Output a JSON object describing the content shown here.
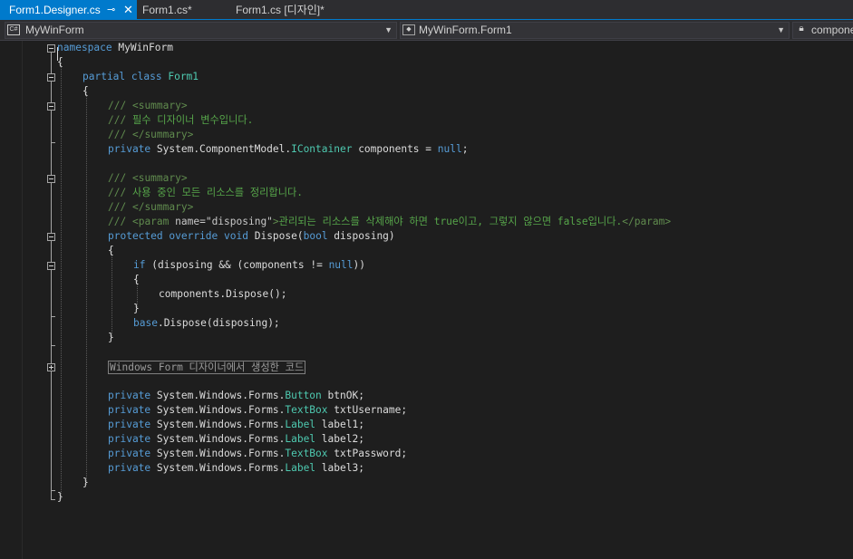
{
  "tabs": [
    {
      "label": "Form1.Designer.cs",
      "active": true,
      "pin": "⊸",
      "close": "✕"
    },
    {
      "label": "Form1.cs*"
    },
    {
      "label": "Form1.cs [디자인]*"
    }
  ],
  "navbar": {
    "project": {
      "icon": "C#",
      "label": "MyWinForm"
    },
    "class": {
      "label": "MyWinForm.Form1"
    },
    "member": {
      "label": "compone"
    }
  },
  "code": {
    "namespace_kw": "namespace",
    "namespace_name": " MyWinForm",
    "open_brace": "{",
    "close_brace": "}",
    "partial_kw": "partial",
    "class_kw": "class",
    "form_name": "Form1",
    "doc_prefix": "///",
    "summary_open": "<summary>",
    "summary_close": "</summary>",
    "comment_var": "필수 디자이너 변수입니다.",
    "private_kw": "private",
    "component_model": "System.ComponentModel.",
    "icontainer": "IContainer",
    "components_decl": " components = ",
    "null_kw": "null",
    "semi": ";",
    "comment_cleanup": "사용 중인 모든 리소스를 정리합니다.",
    "param_open_a": "<param",
    "param_name_attr": "name=",
    "param_disposing_val": "\"disposing\"",
    "param_open_b": ">",
    "param_desc": "관리되는 리소스를 삭제해야 하면 true이고, 그렇지 않으면 false입니다.",
    "param_close": "</param>",
    "protected_kw": "protected",
    "override_kw": "override",
    "void_kw": "void",
    "dispose_name": "Dispose(",
    "bool_kw": "bool",
    "dispose_param": " disposing)",
    "if_kw": "if",
    "if_cond_a": " (disposing && (components != ",
    "if_cond_b": "))",
    "components_dispose": "components.Dispose();",
    "base_kw": "base",
    "base_dispose": ".Dispose(disposing);",
    "region_label": "Windows Form 디자이너에서 생성한 코드",
    "forms_ns": "System.Windows.Forms.",
    "fields": [
      {
        "type": "Button",
        "name": "btnOK;"
      },
      {
        "type": "TextBox",
        "name": "txtUsername;"
      },
      {
        "type": "Label",
        "name": "label1;"
      },
      {
        "type": "Label",
        "name": "label2;"
      },
      {
        "type": "TextBox",
        "name": "txtPassword;"
      },
      {
        "type": "Label",
        "name": "label3;"
      }
    ]
  },
  "colors": {
    "background": "#1e1e1e",
    "keyword": "#569cd6",
    "type": "#4ec9b0",
    "comment": "#57a64a",
    "active_tab": "#007acc"
  }
}
